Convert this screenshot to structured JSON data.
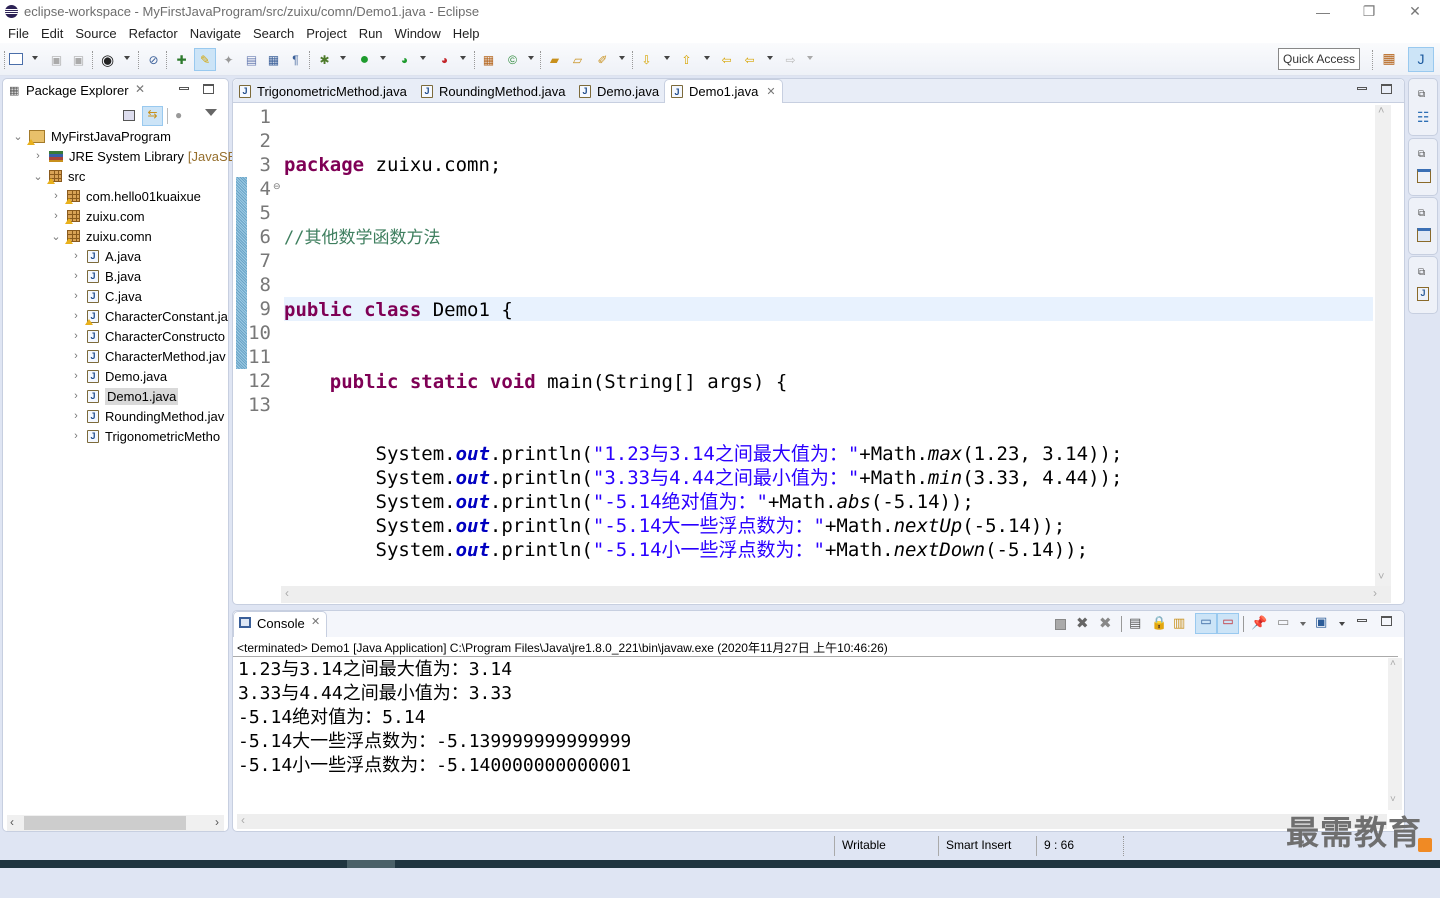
{
  "window": {
    "title": "eclipse-workspace - MyFirstJavaProgram/src/zuixu/comn/Demo1.java - Eclipse",
    "controls": {
      "minimize": "—",
      "restore": "❐",
      "close": "✕"
    }
  },
  "menu": [
    "File",
    "Edit",
    "Source",
    "Refactor",
    "Navigate",
    "Search",
    "Project",
    "Run",
    "Window",
    "Help"
  ],
  "toolbar": {
    "quick_access": "Quick Access",
    "icons": [
      "new-wizard-icon",
      "save-icon",
      "save-all-icon",
      "profile-icon",
      "skip-breakpoints-icon",
      "open-type-icon",
      "toggle-mark-occurrences-icon",
      "show-whitespace-icon",
      "toggle-block-selection-icon",
      "show-source-icon",
      "debug-icon",
      "run-icon",
      "coverage-icon",
      "external-tools-icon",
      "new-java-package-icon",
      "new-java-class-icon",
      "open-type-hierarchy-icon",
      "open-task-icon",
      "search-icon",
      "next-annotation-icon",
      "previous-annotation-icon",
      "last-edit-location-icon",
      "back-icon",
      "forward-icon"
    ]
  },
  "package_explorer": {
    "title": "Package Explorer",
    "tree": [
      {
        "label": "MyFirstJavaProgram",
        "level": 0,
        "expanded": true,
        "kind": "project"
      },
      {
        "label": "JRE System Library",
        "suffix": "[JavaSE-",
        "level": 1,
        "expanded": false,
        "kind": "library"
      },
      {
        "label": "src",
        "level": 1,
        "expanded": true,
        "kind": "source-folder"
      },
      {
        "label": "com.hello01kuaixue",
        "level": 2,
        "expanded": false,
        "kind": "package"
      },
      {
        "label": "zuixu.com",
        "level": 2,
        "expanded": false,
        "kind": "package"
      },
      {
        "label": "zuixu.comn",
        "level": 2,
        "expanded": true,
        "kind": "package"
      },
      {
        "label": "A.java",
        "level": 3,
        "kind": "file"
      },
      {
        "label": "B.java",
        "level": 3,
        "kind": "file"
      },
      {
        "label": "C.java",
        "level": 3,
        "kind": "file"
      },
      {
        "label": "CharacterConstant.ja",
        "level": 3,
        "kind": "file",
        "warning": true
      },
      {
        "label": "CharacterConstructo",
        "level": 3,
        "kind": "file"
      },
      {
        "label": "CharacterMethod.jav",
        "level": 3,
        "kind": "file"
      },
      {
        "label": "Demo.java",
        "level": 3,
        "kind": "file"
      },
      {
        "label": "Demo1.java",
        "level": 3,
        "kind": "file",
        "selected": true
      },
      {
        "label": "RoundingMethod.jav",
        "level": 3,
        "kind": "file"
      },
      {
        "label": "TrigonometricMetho",
        "level": 3,
        "kind": "file"
      }
    ]
  },
  "editor": {
    "tabs": [
      {
        "label": "TrigonometricMethod.java",
        "active": false
      },
      {
        "label": "RoundingMethod.java",
        "active": false
      },
      {
        "label": "Demo.java",
        "active": false
      },
      {
        "label": "Demo1.java",
        "active": true
      }
    ],
    "line_numbers": [
      "1",
      "2",
      "3",
      "4",
      "5",
      "6",
      "7",
      "8",
      "9",
      "10",
      "11",
      "12",
      "13"
    ],
    "current_line": 9,
    "code": {
      "l1_kw": "package",
      "l1_rest": " zuixu.comn;",
      "l2_comment": "//其他数学函数方法",
      "l3_kw": "public class",
      "l3_rest": " Demo1 {",
      "l4_indent": "    ",
      "l4_kw": "public static void",
      "l4_rest": " main(String[] args) {",
      "prints": [
        {
          "prefix": "        System.",
          "field": "out",
          "mid": ".println(",
          "str": "\"1.23与3.14之间最大值为：\"",
          "plus": "+Math.",
          "method": "max",
          "args": "(1.23, 3.14));"
        },
        {
          "prefix": "        System.",
          "field": "out",
          "mid": ".println(",
          "str": "\"3.33与4.44之间最小值为：\"",
          "plus": "+Math.",
          "method": "min",
          "args": "(3.33, 4.44));"
        },
        {
          "prefix": "        System.",
          "field": "out",
          "mid": ".println(",
          "str": "\"-5.14绝对值为：\"",
          "plus": "+Math.",
          "method": "abs",
          "args": "(-5.14));"
        },
        {
          "prefix": "        System.",
          "field": "out",
          "mid": ".println(",
          "str": "\"-5.14大一些浮点数为：\"",
          "plus": "+Math.",
          "method": "nextUp",
          "args": "(-5.14));"
        },
        {
          "prefix": "        System.",
          "field": "out",
          "mid": ".println(",
          "str": "\"-5.14小一些浮点数为：\"",
          "plus": "+Math.",
          "method": "nextDown",
          "args": "(-5.14));"
        }
      ],
      "l11": "    }",
      "l12": "}"
    }
  },
  "console": {
    "title": "Console",
    "status": "<terminated> Demo1 [Java Application] C:\\Program Files\\Java\\jre1.8.0_221\\bin\\javaw.exe (2020年11月27日 上午10:46:26)",
    "output": [
      "1.23与3.14之间最大值为：3.14",
      "3.33与4.44之间最小值为：3.33",
      "-5.14绝对值为：5.14",
      "-5.14大一些浮点数为：-5.139999999999999",
      "-5.14小一些浮点数为：-5.140000000000001"
    ]
  },
  "statusbar": {
    "writable": "Writable",
    "insert_mode": "Smart Insert",
    "position": "9 : 66"
  },
  "watermark": "最需教育"
}
